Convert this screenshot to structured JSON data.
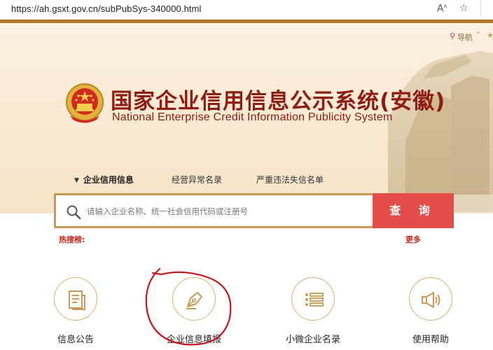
{
  "browser": {
    "url": "https://ah.gsxt.gov.cn/subPubSys-340000.html",
    "read_aloud_icon": "read-aloud-icon",
    "favorite_icon": "star-icon"
  },
  "topnav": {
    "nav_label": "导航"
  },
  "header": {
    "title_cn": "国家企业信用信息公示系统(安徽)",
    "title_en": "National Enterprise Credit Information Publicity System"
  },
  "tabs": [
    {
      "label": "企业信用信息",
      "active": true
    },
    {
      "label": "经营异常名录",
      "active": false
    },
    {
      "label": "严重违法失信名单",
      "active": false
    }
  ],
  "search": {
    "placeholder": "请输入企业名称、统一社会信用代码或注册号",
    "button_label": "查 询"
  },
  "hot": {
    "label": "热搜榜:",
    "more": "更多"
  },
  "features": [
    {
      "label": "信息公告",
      "icon": "document-icon"
    },
    {
      "label": "企业信息填报",
      "icon": "pen-icon"
    },
    {
      "label": "小微企业名录",
      "icon": "list-icon"
    },
    {
      "label": "使用帮助",
      "icon": "megaphone-icon"
    }
  ],
  "colors": {
    "brand_red": "#8e1c12",
    "search_button": "#e34e4a",
    "gold": "#b07b2c"
  }
}
